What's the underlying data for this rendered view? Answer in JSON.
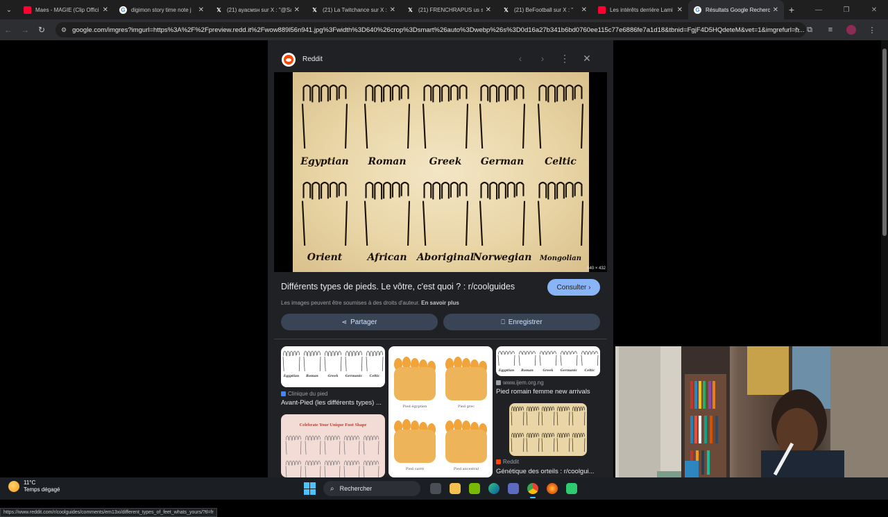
{
  "browser": {
    "tabs": [
      {
        "title": "Maes - MAGIE (Clip Offici",
        "icon": "youtube-icon",
        "color": "#ff0033",
        "active": false
      },
      {
        "title": "digimon story time note j",
        "icon": "google-icon",
        "color": "#ffffff",
        "active": false
      },
      {
        "title": "(21) ayacмsн sur X : \"@Sa",
        "icon": "x-icon",
        "color": "#ffffff",
        "active": false
      },
      {
        "title": "(21) La Twitchance sur X :",
        "icon": "x-icon",
        "color": "#ffffff",
        "active": false
      },
      {
        "title": "(21) FRENCHRAPUS us sur",
        "icon": "x-icon",
        "color": "#ffffff",
        "active": false
      },
      {
        "title": "(21) BeFootball sur X : \"",
        "icon": "x-icon",
        "color": "#ffffff",
        "active": false
      },
      {
        "title": "Les intérêts derrière Lami",
        "icon": "youtube-icon",
        "color": "#ff0033",
        "active": false
      },
      {
        "title": "Résultats Google Recherc",
        "icon": "google-icon",
        "color": "#ffffff",
        "active": true
      }
    ],
    "url": "google.com/imgres?imgurl=https%3A%2F%2Fpreview.redd.it%2Fwow889l56n941.jpg%3Fwidth%3D640%26crop%3Dsmart%26auto%3Dwebp%26s%3D0d16a27b341b6bd0760ee115c77e6886fe7a1d18&tbnid=FgjF4D5HQdeteM&vet=1&imgrefurl=h..."
  },
  "panel": {
    "source": "Reddit",
    "image_dims": "640 × 432",
    "image_labels_top": [
      "Egyptian",
      "Roman",
      "Greek",
      "German",
      "Celtic"
    ],
    "image_labels_bottom": [
      "Orient",
      "African",
      "Aboriginal",
      "Norwegian",
      "Mongolian"
    ],
    "title": "Différents types de pieds. Le vôtre, c'est quoi ? : r/coolguides",
    "visit_label": "Consulter",
    "rights_text": "Les images peuvent être soumises à des droits d'auteur.",
    "rights_link": "En savoir plus",
    "share_label": "Partager",
    "save_label": "Enregistrer"
  },
  "related": [
    {
      "source": "Clinique du pied",
      "title": "Avant-Pied (les différents types) ...",
      "thumb_labels": [
        "Egyptian",
        "Roman",
        "Greek",
        "Germanic",
        "Celtic"
      ]
    },
    {
      "source": "",
      "title": "",
      "thumb_labels": [
        "Pied égyptien",
        "Pied grec",
        "Pied carré",
        "Pied ancestral"
      ]
    },
    {
      "source": "www.ijem.org.ng",
      "title": "Pied romain femme new arrivals",
      "thumb_labels": [
        "Egyptian",
        "Roman",
        "Greek",
        "Germanic",
        "Celtic"
      ]
    },
    {
      "source": "",
      "title": "",
      "thumb_labels": [
        "Celebrate Your Unique Foot Shape"
      ]
    },
    {
      "source": "Reddit",
      "title": "Génétique des orteils : r/coolgui...",
      "thumb_labels": []
    }
  ],
  "status_url": "https://www.reddit.com/r/coolguides/comments/em13xi/different_types_of_feet_whats_yours/?tl=fr",
  "taskbar": {
    "temp": "11°C",
    "condition": "Temps dégagé",
    "search_placeholder": "Rechercher"
  }
}
